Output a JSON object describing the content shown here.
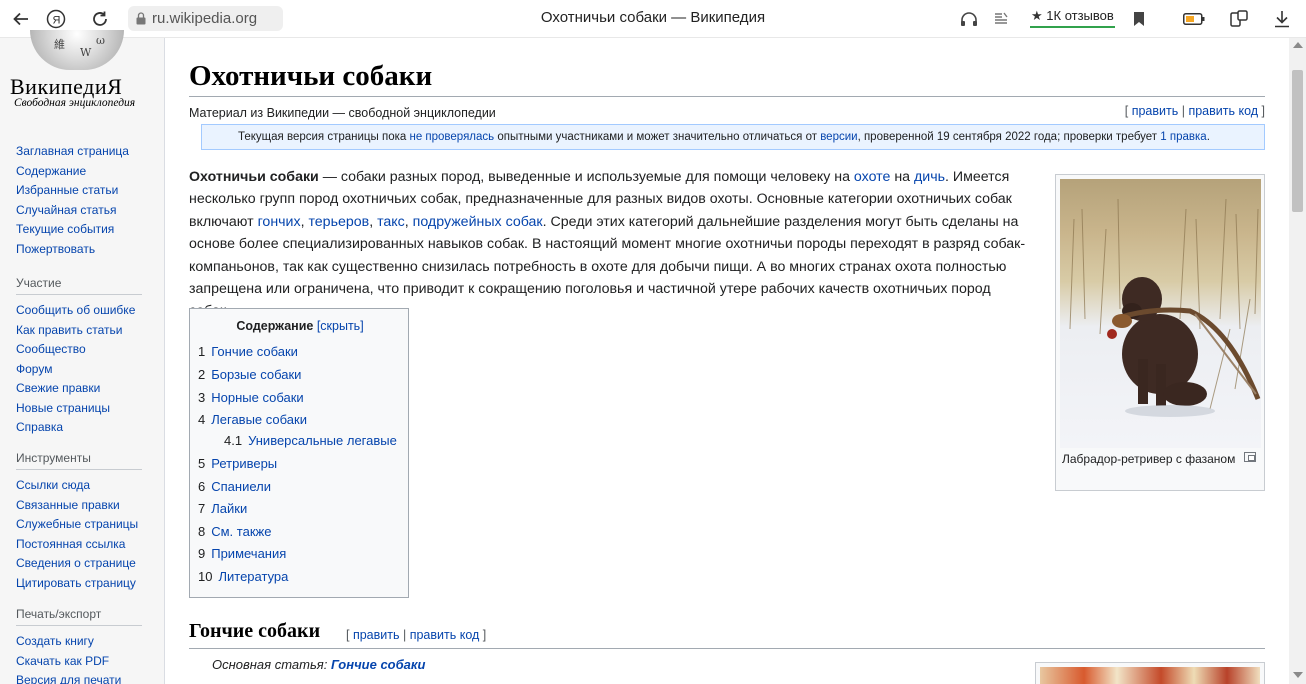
{
  "browser": {
    "url": "ru.wikipedia.org",
    "tab_title": "Охотничьи собаки — Википедия",
    "reviews": "1К отзывов",
    "icons": [
      "back-arrow-icon",
      "yandex-icon",
      "reload-icon",
      "lock-icon",
      "headphones-icon",
      "reader-icon",
      "star-icon",
      "bookmark-icon",
      "battery-icon",
      "extensions-icon",
      "download-icon"
    ]
  },
  "sidebar": {
    "logo_title": "ВикипедиЯ",
    "logo_subtitle": "Свободная энциклопедия",
    "main_items": [
      "Заглавная страница",
      "Содержание",
      "Избранные статьи",
      "Случайная статья",
      "Текущие события",
      "Пожертвовать"
    ],
    "participation": {
      "heading": "Участие",
      "items": [
        "Сообщить об ошибке",
        "Как править статьи",
        "Сообщество",
        "Форум",
        "Свежие правки",
        "Новые страницы",
        "Справка"
      ]
    },
    "tools": {
      "heading": "Инструменты",
      "items": [
        "Ссылки сюда",
        "Связанные правки",
        "Служебные страницы",
        "Постоянная ссылка",
        "Сведения о странице",
        "Цитировать страницу"
      ]
    },
    "print": {
      "heading": "Печать/экспорт",
      "items": [
        "Создать книгу",
        "Скачать как PDF",
        "Версия для печати"
      ]
    }
  },
  "article": {
    "title": "Охотничьи собаки",
    "site_sub": "Материал из Википедии — свободной энциклопедии",
    "edit_links": {
      "open": "[ ",
      "edit": "править",
      "sep": " | ",
      "edit_code": "править код",
      "close": " ]"
    },
    "notice": {
      "t1": "Текущая версия страницы пока ",
      "l1": "не проверялась",
      "t2": " опытными участниками и может значительно отличаться от ",
      "l2": "версии",
      "t3": ", проверенной 19 сентября 2022 года; проверки требует ",
      "l3": "1 правка",
      "t4": "."
    },
    "intro": {
      "bold": "Охотничьи собаки",
      "t1": " — собаки разных пород, выведенные и используемые для помощи человеку на ",
      "l1": "охоте",
      "t2": " на ",
      "l2": "дичь",
      "t3": ". Имеется несколько групп пород охотничьих собак, предназначенные для разных видов охоты. Основные категории охотничьих собак включают ",
      "l3": "гончих",
      "c1": ", ",
      "l4": "терьеров",
      "c2": ", ",
      "l5": "такс",
      "c3": ", ",
      "l6": "подружейных собак",
      "t4": ". Среди этих категорий дальнейшие разделения могут быть сделаны на основе более специализированных навыков собак. В настоящий момент многие охотничьи породы переходят в разряд собак-компаньонов, так как существенно снизилась потребность в охоте для добычи пищи. А во многих странах охота полностью запрещена или ограничена, что приводит к сокращению поголовья и частичной утере рабочих качеств охотничьих пород собак."
    },
    "image_caption": "Лабрадор-ретривер с фазаном",
    "toc": {
      "title": "Содержание",
      "hide": "[скрыть]",
      "items": [
        {
          "num": "1",
          "label": "Гончие собаки"
        },
        {
          "num": "2",
          "label": "Борзые собаки"
        },
        {
          "num": "3",
          "label": "Норные собаки"
        },
        {
          "num": "4",
          "label": "Легавые собаки"
        },
        {
          "num": "4.1",
          "label": "Универсальные легавые"
        },
        {
          "num": "5",
          "label": "Ретриверы"
        },
        {
          "num": "6",
          "label": "Спаниели"
        },
        {
          "num": "7",
          "label": "Лайки"
        },
        {
          "num": "8",
          "label": "См. также"
        },
        {
          "num": "9",
          "label": "Примечания"
        },
        {
          "num": "10",
          "label": "Литература"
        }
      ]
    },
    "section1": {
      "title": "Гончие собаки",
      "edit": {
        "open": "[ ",
        "edit": "править",
        "sep": " | ",
        "edit_code": "править код",
        "close": " ]"
      },
      "hatnote_prefix": "Основная статья: ",
      "hatnote_link": "Гончие собаки"
    }
  }
}
